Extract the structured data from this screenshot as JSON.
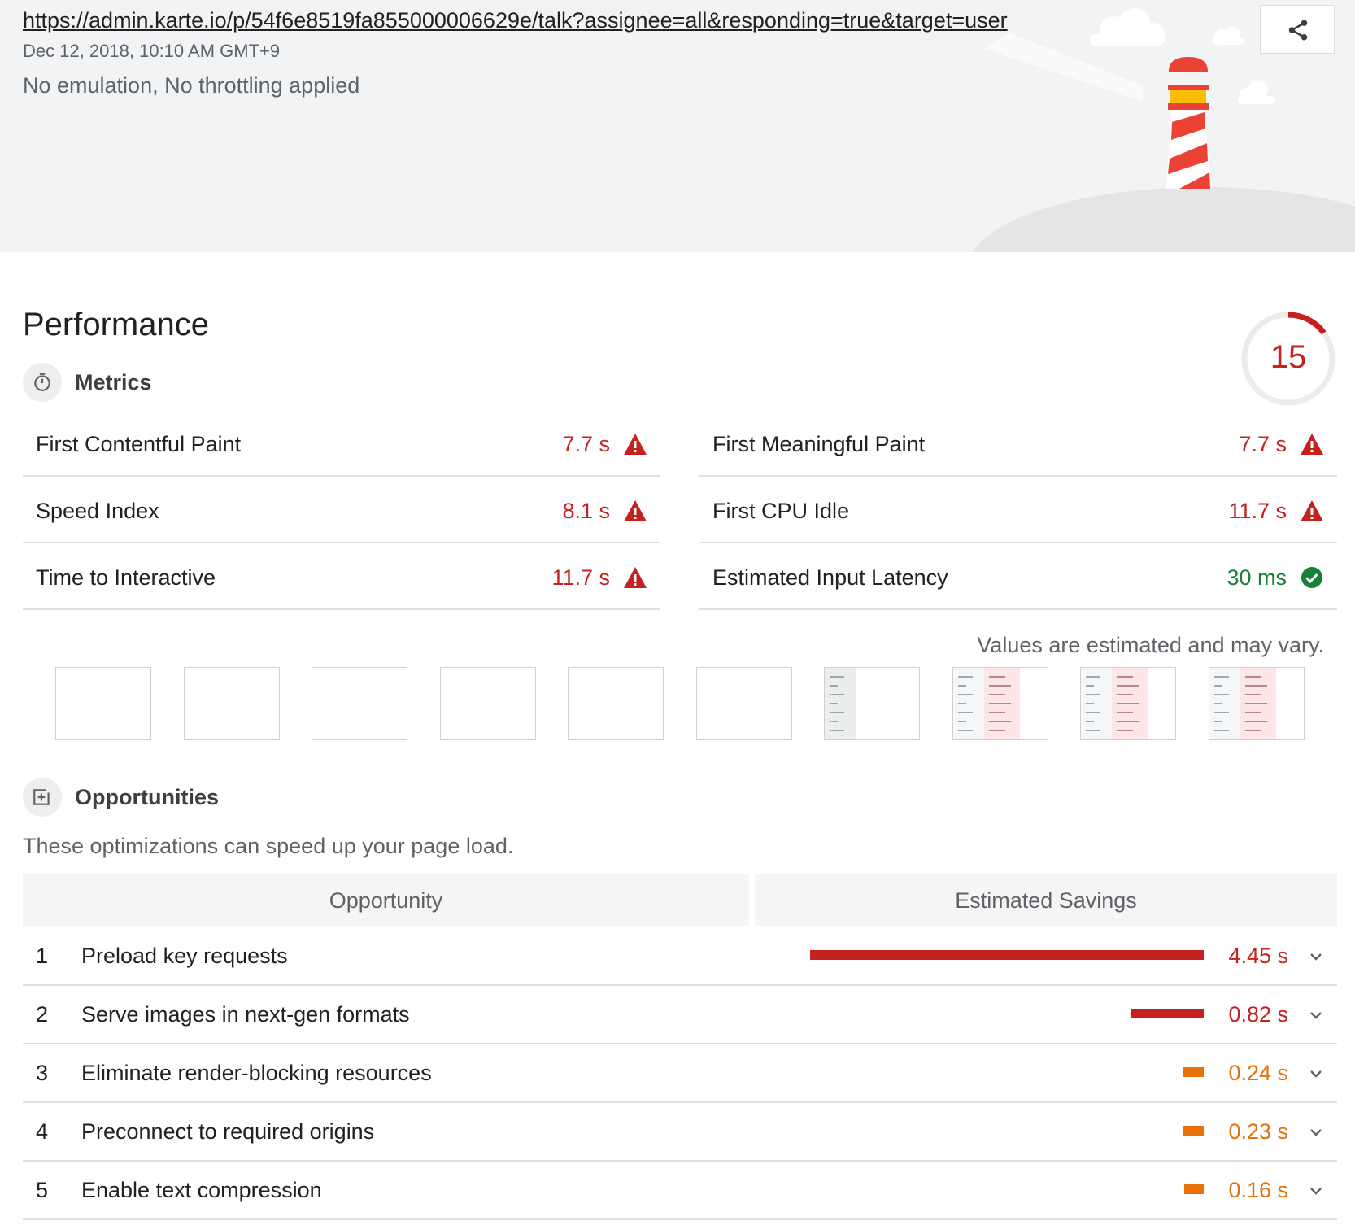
{
  "header": {
    "url": "https://admin.karte.io/p/54f6e8519fa855000006629e/talk?assignee=all&responding=true&target=user",
    "date": "Dec 12, 2018, 10:10 AM GMT+9",
    "environment": "No emulation, No throttling applied",
    "share_icon": "share-icon"
  },
  "performance": {
    "title": "Performance",
    "score": "15",
    "score_fraction": 0.15,
    "score_color": "#c5221f",
    "metrics_label": "Metrics",
    "metrics": [
      {
        "name": "First Contentful Paint",
        "value": "7.7 s",
        "status": "fail"
      },
      {
        "name": "First Meaningful Paint",
        "value": "7.7 s",
        "status": "fail"
      },
      {
        "name": "Speed Index",
        "value": "8.1 s",
        "status": "fail"
      },
      {
        "name": "First CPU Idle",
        "value": "11.7 s",
        "status": "fail"
      },
      {
        "name": "Time to Interactive",
        "value": "11.7 s",
        "status": "fail"
      },
      {
        "name": "Estimated Input Latency",
        "value": "30 ms",
        "status": "pass"
      }
    ],
    "note": "Values are estimated and may vary."
  },
  "opportunities": {
    "label": "Opportunities",
    "description": "These optimizations can speed up your page load.",
    "col_opportunity": "Opportunity",
    "col_savings": "Estimated Savings",
    "items": [
      {
        "num": "1",
        "title": "Preload key requests",
        "savings": "4.45 s",
        "seconds": 4.45,
        "level": "fail"
      },
      {
        "num": "2",
        "title": "Serve images in next-gen formats",
        "savings": "0.82 s",
        "seconds": 0.82,
        "level": "fail"
      },
      {
        "num": "3",
        "title": "Eliminate render-blocking resources",
        "savings": "0.24 s",
        "seconds": 0.24,
        "level": "average"
      },
      {
        "num": "4",
        "title": "Preconnect to required origins",
        "savings": "0.23 s",
        "seconds": 0.23,
        "level": "average"
      },
      {
        "num": "5",
        "title": "Enable text compression",
        "savings": "0.16 s",
        "seconds": 0.16,
        "level": "average"
      }
    ]
  },
  "colors": {
    "fail": "#c5221f",
    "average": "#e8710a",
    "pass": "#188038"
  }
}
